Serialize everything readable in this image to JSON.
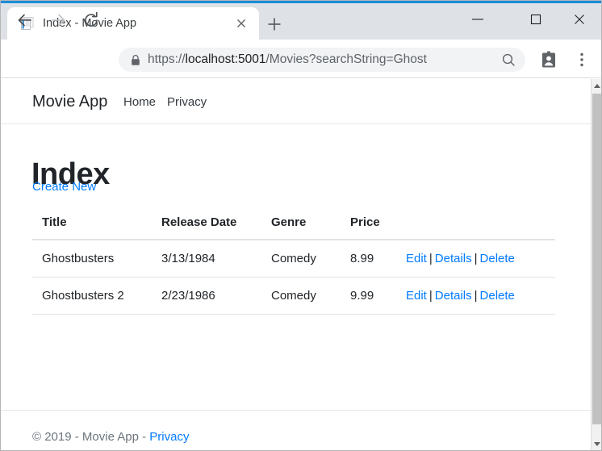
{
  "browser": {
    "tab": {
      "title": "Index - Movie App",
      "favicon_icon": "document-stack-icon",
      "close_icon": "close-icon"
    },
    "new_tab_icon": "plus-icon",
    "window_controls": {
      "minimize_icon": "minimize-icon",
      "maximize_icon": "maximize-icon",
      "close_icon": "close-icon"
    },
    "toolbar": {
      "back_icon": "arrow-left-icon",
      "forward_icon": "arrow-right-icon",
      "reload_icon": "reload-icon",
      "lock_icon": "lock-icon",
      "search_icon": "search-icon",
      "profile_icon": "profile-card-icon",
      "menu_icon": "three-dots-menu-icon",
      "url_scheme": "https://",
      "url_host": "localhost:5001",
      "url_path": "/Movies?searchString=Ghost",
      "url_full": "https://localhost:5001/Movies?searchString=Ghost"
    },
    "accent_color": "#1a8cd8",
    "scrollbar": {
      "up_arrow_icon": "triangle-up-icon",
      "down_arrow_icon": "triangle-down-icon"
    }
  },
  "page": {
    "navbar": {
      "brand": "Movie App",
      "links": [
        {
          "label": "Home"
        },
        {
          "label": "Privacy"
        }
      ]
    },
    "heading": "Index",
    "create_new_label": "Create New",
    "table": {
      "columns": [
        "Title",
        "Release Date",
        "Genre",
        "Price"
      ],
      "action_labels": {
        "edit": "Edit",
        "details": "Details",
        "delete": "Delete",
        "separator": "|"
      },
      "rows": [
        {
          "title": "Ghostbusters",
          "release_date": "3/13/1984",
          "genre": "Comedy",
          "price": "8.99"
        },
        {
          "title": "Ghostbusters 2",
          "release_date": "2/23/1986",
          "genre": "Comedy",
          "price": "9.99"
        }
      ]
    },
    "footer": {
      "copyright": "© 2019 - Movie App - ",
      "privacy_label": "Privacy"
    },
    "link_color": "#007bff"
  }
}
